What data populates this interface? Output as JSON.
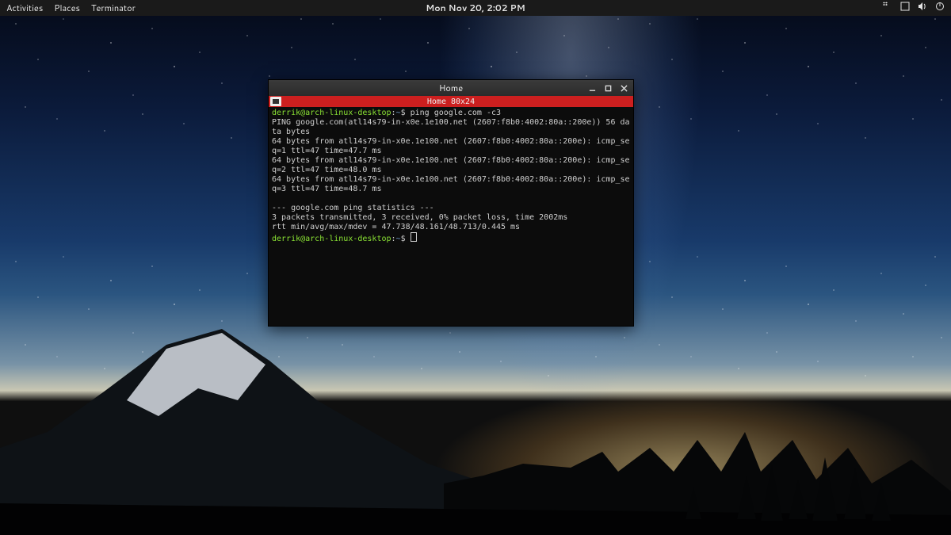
{
  "topbar": {
    "activities": "Activities",
    "places": "Places",
    "app": "Terminator",
    "clock": "Mon Nov 20,  2:02 PM"
  },
  "tray_icons": [
    "dropbox-icon",
    "tray-square-icon",
    "volume-icon",
    "power-icon"
  ],
  "window": {
    "title": "Home",
    "tab_title": "Home  80x24"
  },
  "terminal": {
    "prompt_user": "derrik@arch-linux-desktop",
    "prompt_path": "~",
    "prompt_symbol": "$",
    "command": "ping google.com -c3",
    "output_lines": [
      "PING google.com(atl14s79-in-x0e.1e100.net (2607:f8b0:4002:80a::200e)) 56 data bytes",
      "64 bytes from atl14s79-in-x0e.1e100.net (2607:f8b0:4002:80a::200e): icmp_seq=1 ttl=47 time=47.7 ms",
      "64 bytes from atl14s79-in-x0e.1e100.net (2607:f8b0:4002:80a::200e): icmp_seq=2 ttl=47 time=48.0 ms",
      "64 bytes from atl14s79-in-x0e.1e100.net (2607:f8b0:4002:80a::200e): icmp_seq=3 ttl=47 time=48.7 ms",
      "",
      "--- google.com ping statistics ---",
      "3 packets transmitted, 3 received, 0% packet loss, time 2002ms",
      "rtt min/avg/max/mdev = 47.738/48.161/48.713/0.445 ms"
    ]
  }
}
